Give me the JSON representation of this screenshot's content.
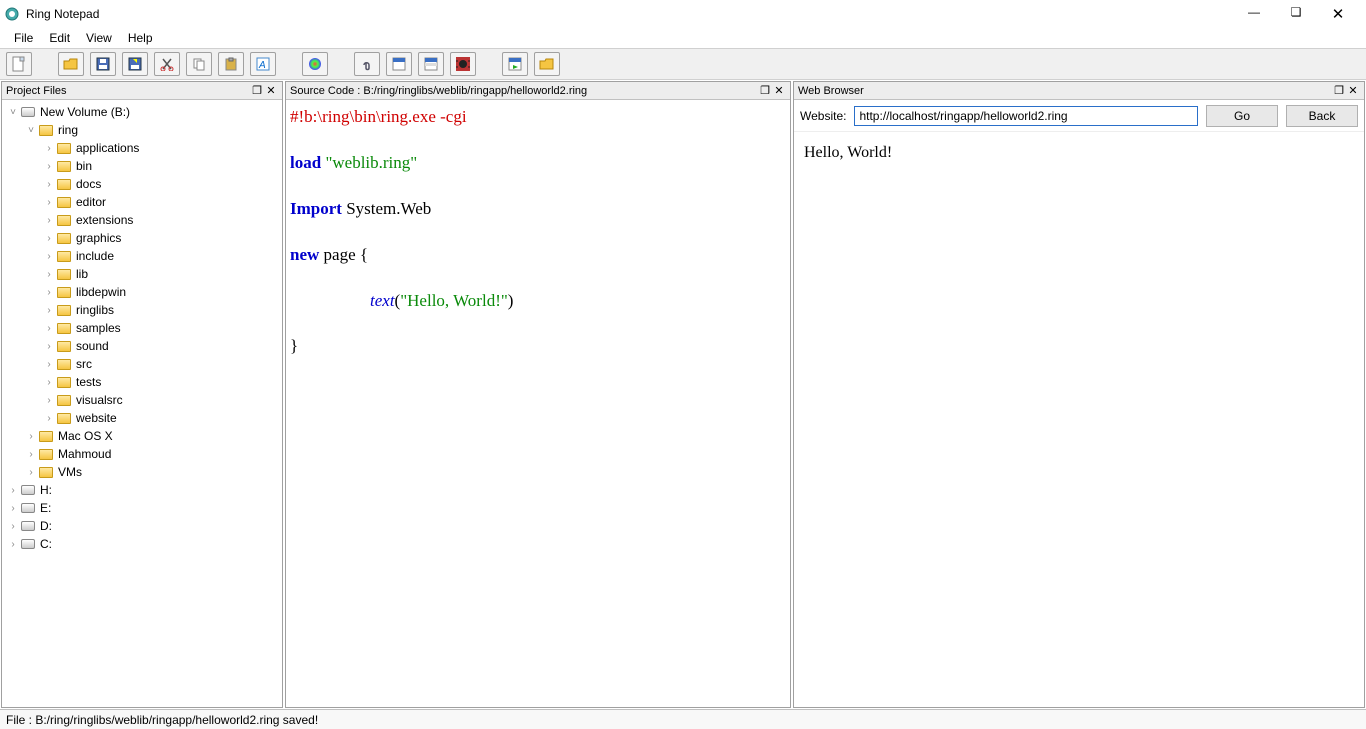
{
  "app_title": "Ring Notepad",
  "menubar": [
    "File",
    "Edit",
    "View",
    "Help"
  ],
  "toolbar_icons": [
    "new",
    "open",
    "save",
    "saveas",
    "cut",
    "copy",
    "paste",
    "font",
    "color",
    "clip",
    "view",
    "view2",
    "bug",
    "run",
    "folder"
  ],
  "panels": {
    "project": {
      "title": "Project Files"
    },
    "source": {
      "title": "Source Code : B:/ring/ringlibs/weblib/ringapp/helloworld2.ring"
    },
    "browser": {
      "title": "Web Browser"
    }
  },
  "tree": {
    "root": "New Volume (B:)",
    "ring": "ring",
    "ring_children": [
      "applications",
      "bin",
      "docs",
      "editor",
      "extensions",
      "graphics",
      "include",
      "lib",
      "libdepwin",
      "ringlibs",
      "samples",
      "sound",
      "src",
      "tests",
      "visualsrc",
      "website"
    ],
    "siblings": [
      "Mac OS X",
      "Mahmoud",
      "VMs"
    ],
    "drives": [
      "H:",
      "E:",
      "D:",
      "C:"
    ]
  },
  "code": {
    "shebang": "#!b:\\ring\\bin\\ring.exe -cgi",
    "load_kw": "load",
    "load_str": " \"weblib.ring\"",
    "import_kw": "Import",
    "import_txt": " System.Web",
    "new_kw": "new",
    "new_txt": " page {",
    "fn": "text",
    "fn_arg_open": "(",
    "fn_str": "\"Hello, World!\"",
    "fn_arg_close": ")",
    "close": "}"
  },
  "browser": {
    "label": "Website:",
    "url": "http://localhost/ringapp/helloworld2.ring",
    "go": "Go",
    "back": "Back",
    "content": "Hello, World!"
  },
  "status": "File : B:/ring/ringlibs/weblib/ringapp/helloworld2.ring saved!"
}
